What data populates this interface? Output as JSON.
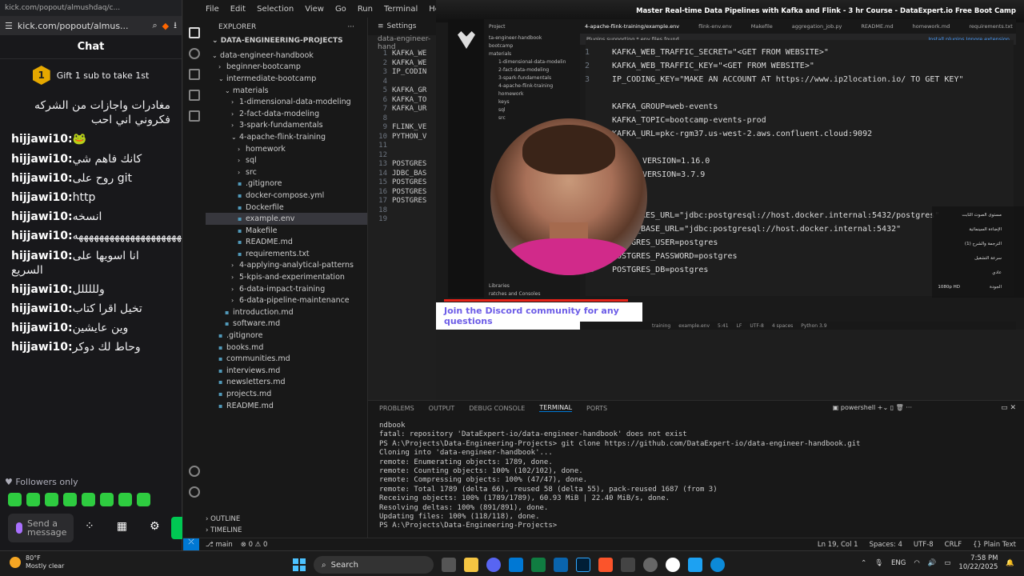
{
  "chat": {
    "titlebar": "kick.com/popout/almushdaq/c...",
    "url": "kick.com/popout/almus...",
    "header": "Chat",
    "gift_count": "1",
    "gift_text": "Gift 1 sub to take 1st",
    "messages": [
      {
        "user": "",
        "text": "مغادرات واجازات من الشركه فكروني اني احب"
      },
      {
        "user": "hijjawi10:",
        "text": "🐸"
      },
      {
        "user": "hijjawi10:",
        "text": "كانك فاهم شي"
      },
      {
        "user": "hijjawi10:",
        "text": "روح على git"
      },
      {
        "user": "hijjawi10:",
        "text": "http"
      },
      {
        "user": "hijjawi10:",
        "text": "انسخه"
      },
      {
        "user": "hijjawi10:",
        "text": "ههههههههههههههههههههههههههه"
      },
      {
        "user": "hijjawi10:",
        "text": "انا اسويها على السريع"
      },
      {
        "user": "hijjawi10:",
        "text": "ولللللل"
      },
      {
        "user": "hijjawi10:",
        "text": "تخيل اقرا كتاب"
      },
      {
        "user": "hijjawi10:",
        "text": "وين عايشين"
      },
      {
        "user": "hijjawi10:",
        "text": "وحاط لك دوكر"
      }
    ],
    "followers_only": "Followers only",
    "input_placeholder": "Send a message"
  },
  "vscode": {
    "menu": [
      "File",
      "Edit",
      "Selection",
      "View",
      "Go",
      "Run",
      "Terminal",
      "Help"
    ],
    "explorer_label": "EXPLORER",
    "project": "DATA-ENGINEERING-PROJECTS",
    "tree": [
      {
        "indent": 1,
        "chev": "⌄",
        "label": "data-engineer-handbook"
      },
      {
        "indent": 2,
        "chev": "›",
        "label": "beginner-bootcamp"
      },
      {
        "indent": 2,
        "chev": "⌄",
        "label": "intermediate-bootcamp"
      },
      {
        "indent": 3,
        "chev": "⌄",
        "label": "materials"
      },
      {
        "indent": 4,
        "chev": "›",
        "label": "1-dimensional-data-modeling"
      },
      {
        "indent": 4,
        "chev": "›",
        "label": "2-fact-data-modeling"
      },
      {
        "indent": 4,
        "chev": "›",
        "label": "3-spark-fundamentals"
      },
      {
        "indent": 4,
        "chev": "⌄",
        "label": "4-apache-flink-training"
      },
      {
        "indent": 5,
        "chev": "›",
        "label": "homework"
      },
      {
        "indent": 5,
        "chev": "›",
        "label": "sql"
      },
      {
        "indent": 5,
        "chev": "›",
        "label": "src"
      },
      {
        "indent": 5,
        "chev": "",
        "label": ".gitignore"
      },
      {
        "indent": 5,
        "chev": "",
        "label": "docker-compose.yml"
      },
      {
        "indent": 5,
        "chev": "",
        "label": "Dockerfile"
      },
      {
        "indent": 5,
        "chev": "",
        "label": "example.env",
        "selected": true
      },
      {
        "indent": 5,
        "chev": "",
        "label": "Makefile"
      },
      {
        "indent": 5,
        "chev": "",
        "label": "README.md"
      },
      {
        "indent": 5,
        "chev": "",
        "label": "requirements.txt"
      },
      {
        "indent": 4,
        "chev": "›",
        "label": "4-applying-analytical-patterns"
      },
      {
        "indent": 4,
        "chev": "›",
        "label": "5-kpis-and-experimentation"
      },
      {
        "indent": 4,
        "chev": "›",
        "label": "6-data-impact-training"
      },
      {
        "indent": 4,
        "chev": "›",
        "label": "6-data-pipeline-maintenance"
      },
      {
        "indent": 3,
        "chev": "",
        "label": "introduction.md"
      },
      {
        "indent": 3,
        "chev": "",
        "label": "software.md"
      },
      {
        "indent": 2,
        "chev": "",
        "label": ".gitignore"
      },
      {
        "indent": 2,
        "chev": "",
        "label": "books.md"
      },
      {
        "indent": 2,
        "chev": "",
        "label": "communities.md"
      },
      {
        "indent": 2,
        "chev": "",
        "label": "interviews.md"
      },
      {
        "indent": 2,
        "chev": "",
        "label": "newsletters.md"
      },
      {
        "indent": 2,
        "chev": "",
        "label": "projects.md"
      },
      {
        "indent": 2,
        "chev": "",
        "label": "README.md"
      }
    ],
    "editor_tab": "Settings",
    "editor_path": "data-engineer-hand",
    "code_lines": [
      {
        "n": "1",
        "t": "KAFKA_WE"
      },
      {
        "n": "2",
        "t": "KAFKA_WE"
      },
      {
        "n": "3",
        "t": "IP_CODIN"
      },
      {
        "n": "4",
        "t": ""
      },
      {
        "n": "5",
        "t": "KAFKA_GR"
      },
      {
        "n": "6",
        "t": "KAFKA_TO"
      },
      {
        "n": "7",
        "t": "KAFKA_UR"
      },
      {
        "n": "8",
        "t": ""
      },
      {
        "n": "9",
        "t": "FLINK_VE"
      },
      {
        "n": "10",
        "t": "PYTHON_V"
      },
      {
        "n": "11",
        "t": ""
      },
      {
        "n": "12",
        "t": ""
      },
      {
        "n": "13",
        "t": "POSTGRES"
      },
      {
        "n": "14",
        "t": "JDBC_BAS"
      },
      {
        "n": "15",
        "t": "POSTGRES"
      },
      {
        "n": "16",
        "t": "POSTGRES"
      },
      {
        "n": "17",
        "t": "POSTGRES"
      },
      {
        "n": "18",
        "t": ""
      },
      {
        "n": "19",
        "t": ""
      }
    ],
    "panel_tabs": [
      "PROBLEMS",
      "OUTPUT",
      "DEBUG CONSOLE",
      "TERMINAL",
      "PORTS"
    ],
    "panel_active": "TERMINAL",
    "shell": "powershell",
    "terminal_lines": [
      "ndbook",
      "fatal: repository 'DataExpert-io/data-engineer-handbook' does not exist",
      "PS A:\\Projects\\Data-Engineering-Projects> git clone https://github.com/DataExpert-io/data-engineer-handbook.git",
      "Cloning into 'data-engineer-handbook'...",
      "remote: Enumerating objects: 1789, done.",
      "remote: Counting objects: 100% (102/102), done.",
      "remote: Compressing objects: 100% (47/47), done.",
      "remote: Total 1789 (delta 66), reused 58 (delta 55), pack-reused 1687 (from 3)",
      "Receiving objects: 100% (1789/1789), 60.93 MiB | 22.40 MiB/s, done.",
      "Resolving deltas: 100% (891/891), done.",
      "Updating files: 100% (118/118), done.",
      "PS A:\\Projects\\Data-Engineering-Projects> "
    ],
    "outline": "OUTLINE",
    "timeline": "TIMELINE",
    "status_branch": "main",
    "status_errors": "⊗ 0 ⚠ 0",
    "status_right": [
      "Ln 19, Col 1",
      "Spaces: 4",
      "UTF-8",
      "CRLF",
      "{} Plain Text"
    ]
  },
  "video": {
    "title": "Master Real-time Data Pipelines with Kafka and Flink - 3 hr Course - DataExpert.io Free Boot Camp",
    "tabs": [
      "4-apache-flink-training/example.env",
      "flink-env.env",
      "Makefile",
      "aggregation_job.py",
      "README.md",
      "homework.md",
      "requirements.txt"
    ],
    "notice": "Plugins supporting *.env files found.",
    "notice_actions": "Install plugins   Ignore extension",
    "project_label": "Project",
    "side_items": [
      "ta-engineer-handbook",
      "bootcamp",
      "materials",
      "1-dimensional-data-modelin",
      "2-fact-data-modeling",
      "3-spark-fundamentals",
      "4-apache-flink-training",
      "homework",
      "keys",
      "sql",
      "src",
      "Libraries",
      "ratches and Consoles"
    ],
    "lines": [
      {
        "n": "1",
        "t": "KAFKA_WEB_TRAFFIC_SECRET=\"<GET FROM WEBSITE>\""
      },
      {
        "n": "2",
        "t": "KAFKA_WEB_TRAFFIC_KEY=\"<GET FROM WEBSITE>\""
      },
      {
        "n": "3",
        "t": "IP_CODING_KEY=\"MAKE AN ACCOUNT AT https://www.ip2location.io/ TO GET KEY\""
      },
      {
        "n": "",
        "t": ""
      },
      {
        "n": "",
        "t": "KAFKA_GROUP=web-events"
      },
      {
        "n": "",
        "t": "KAFKA_TOPIC=bootcamp-events-prod"
      },
      {
        "n": "",
        "t": "KAFKA_URL=pkc-rgm37.us-west-2.aws.confluent.cloud:9092"
      },
      {
        "n": "",
        "t": ""
      },
      {
        "n": "",
        "t": "VERSION=1.16.0"
      },
      {
        "n": "",
        "t": "VERSION=3.7.9"
      },
      {
        "n": "",
        "t": ""
      },
      {
        "n": "",
        "t": ""
      },
      {
        "n": "",
        "t": "GRES_URL=\"jdbc:postgresql://host.docker.internal:5432/postgres\""
      },
      {
        "n": "",
        "t": "_BASE_URL=\"jdbc:postgresql://host.docker.internal:5432\""
      },
      {
        "n": "",
        "t": "POSTGRES_USER=postgres"
      },
      {
        "n": "",
        "t": "POSTGRES_PASSWORD=postgres"
      },
      {
        "n": "18",
        "t": "POSTGRES_DB=postgres"
      }
    ],
    "banner": "Join the Discord community for any questions",
    "settings": [
      "مستوى الصوت الثابت",
      "الإضاءة السينمائية",
      "الترجمة والشرح (1)",
      "سرعة التشغيل",
      "عادي",
      "الجودة"
    ],
    "settings_values": [
      "",
      "",
      "",
      "",
      "",
      "1080p HD"
    ],
    "status": [
      "training",
      "example.env",
      "5:41",
      "LF",
      "UTF-8",
      "4 spaces",
      "Python 3.9"
    ]
  },
  "taskbar": {
    "temp": "80°F",
    "weather": "Mostly clear",
    "search": "Search",
    "lang": "ENG",
    "time": "7:58 PM",
    "date": "10/22/2025"
  }
}
